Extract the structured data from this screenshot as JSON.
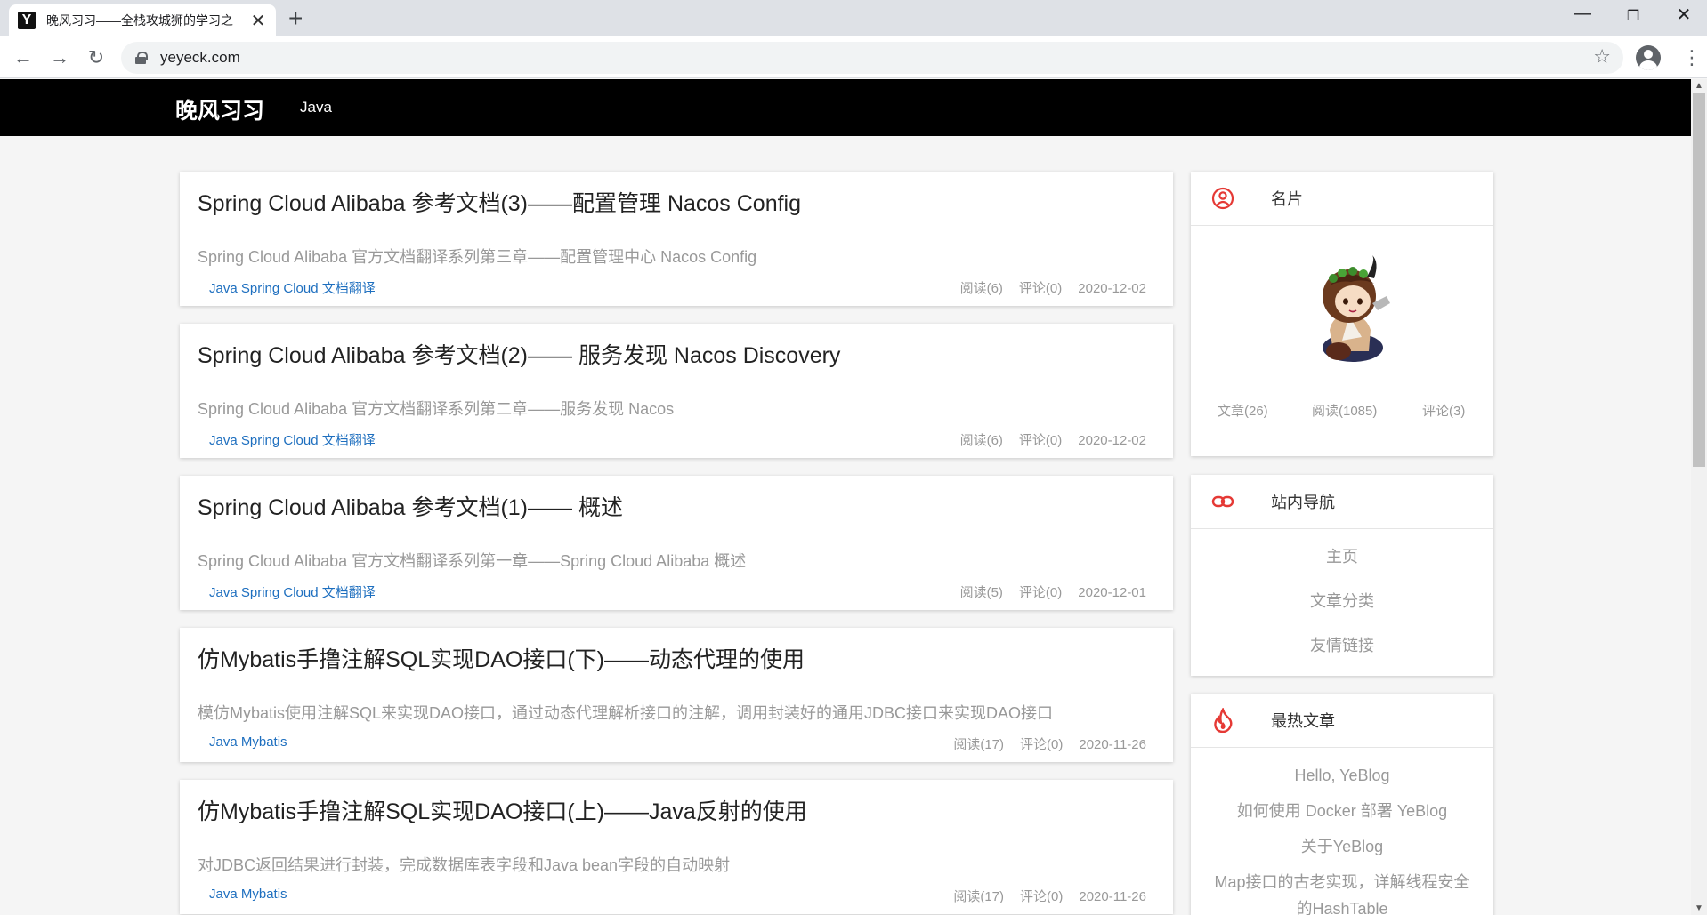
{
  "browser": {
    "tab_title": "晚风习习——全栈攻城狮的学习之",
    "favicon_letter": "Y",
    "url": "yeyeck.com",
    "icons": [
      "back-icon",
      "forward-icon",
      "reload-icon",
      "lock-icon",
      "star-icon",
      "profile-icon",
      "menu-icon"
    ]
  },
  "site": {
    "brand": "晚风习习",
    "nav": [
      {
        "label": "Java"
      }
    ]
  },
  "articles": [
    {
      "title": "Spring Cloud Alibaba 参考文档(3)——配置管理 Nacos Config",
      "summary": "Spring Cloud Alibaba 官方文档翻译系列第三章——配置管理中心 Nacos Config",
      "tags": "Java Spring Cloud 文档翻译",
      "views": "阅读(6)",
      "comments": "评论(0)",
      "date": "2020-12-02"
    },
    {
      "title": "Spring Cloud Alibaba 参考文档(2)—— 服务发现 Nacos Discovery",
      "summary": "Spring Cloud Alibaba 官方文档翻译系列第二章——服务发现 Nacos",
      "tags": "Java Spring Cloud 文档翻译",
      "views": "阅读(6)",
      "comments": "评论(0)",
      "date": "2020-12-02"
    },
    {
      "title": "Spring Cloud Alibaba 参考文档(1)—— 概述",
      "summary": "Spring Cloud Alibaba 官方文档翻译系列第一章——Spring Cloud Alibaba 概述",
      "tags": "Java Spring Cloud 文档翻译",
      "views": "阅读(5)",
      "comments": "评论(0)",
      "date": "2020-12-01"
    },
    {
      "title": "仿Mybatis手撸注解SQL实现DAO接口(下)——动态代理的使用",
      "summary": "模仿Mybatis使用注解SQL来实现DAO接口，通过动态代理解析接口的注解，调用封装好的通用JDBC接口来实现DAO接口",
      "tags": "Java Mybatis",
      "views": "阅读(17)",
      "comments": "评论(0)",
      "date": "2020-11-26"
    },
    {
      "title": "仿Mybatis手撸注解SQL实现DAO接口(上)——Java反射的使用",
      "summary": "对JDBC返回结果进行封装，完成数据库表字段和Java bean字段的自动映射",
      "tags": "Java Mybatis",
      "views": "阅读(17)",
      "comments": "评论(0)",
      "date": "2020-11-26"
    }
  ],
  "sidebar": {
    "profile": {
      "title": "名片",
      "icon": "user-circle-icon",
      "articles": "文章(26)",
      "views": "阅读(1085)",
      "comments": "评论(3)"
    },
    "navigation": {
      "title": "站内导航",
      "icon": "link-icon",
      "links": [
        "主页",
        "文章分类",
        "友情链接"
      ]
    },
    "hot": {
      "title": "最热文章",
      "icon": "fire-icon",
      "items": [
        "Hello, YeBlog",
        "如何使用 Docker 部署 YeBlog",
        "关于YeBlog",
        "Map接口的古老实现，详解线程安全的HashTable"
      ]
    }
  },
  "colors": {
    "header_bg": "#000000",
    "tag_link": "#1e6fbf",
    "accent_icon": "#e53935",
    "muted_text": "#999999"
  }
}
